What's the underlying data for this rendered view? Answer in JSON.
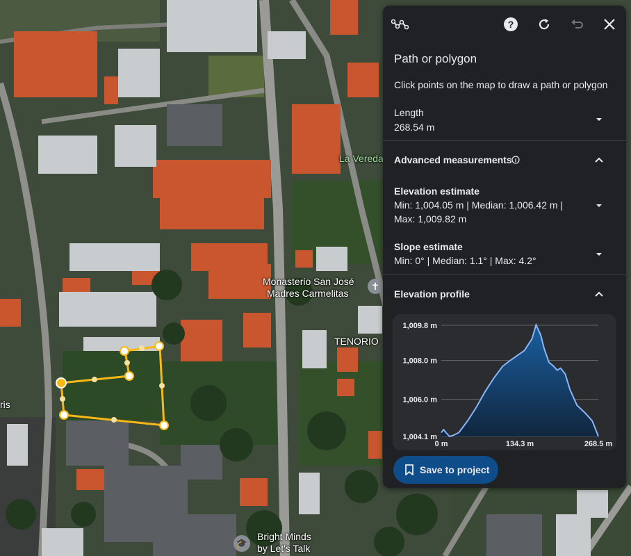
{
  "map": {
    "labels": {
      "la_vereda": "La Vereda",
      "monasterio_1": "Monasterio San José",
      "monasterio_2": "Madres Carmelitas",
      "tenorio": "TENORIO",
      "bright_minds_1": "Bright Minds",
      "bright_minds_2": "by Let's Talk",
      "left_edge": "ris"
    }
  },
  "panel": {
    "tool_icon": "path-measure-icon",
    "title": "Path or polygon",
    "instruction": "Click points on the map to draw a path or polygon",
    "length": {
      "label": "Length",
      "value": "268.54 m"
    },
    "advanced": {
      "label": "Advanced measurements"
    },
    "elevation": {
      "label": "Elevation estimate",
      "line1": "Min: 1,004.05 m | Median: 1,006.42 m |",
      "line2": "Max: 1,009.82 m"
    },
    "slope": {
      "label": "Slope estimate",
      "value": "Min: 0° | Median: 1.1° | Max: 4.2°"
    },
    "profile": {
      "label": "Elevation profile"
    },
    "save_label": "Save to project"
  },
  "colors": {
    "accent": "#0b57d0",
    "panel_bg": "#202124",
    "profile_line": "#8ab4f8",
    "polygon": "#f9b815"
  },
  "chart_data": {
    "type": "area",
    "title": "Elevation profile",
    "xlabel": "",
    "ylabel": "",
    "x_ticks": [
      "0 m",
      "134.3 m",
      "268.5 m"
    ],
    "y_ticks": [
      "1,009.8 m",
      "1,008.0 m",
      "1,006.0 m",
      "1,004.1 m"
    ],
    "y_tick_values": [
      1009.8,
      1008.0,
      1006.0,
      1004.1
    ],
    "xlim": [
      0,
      268.5
    ],
    "ylim": [
      1004.1,
      1009.8
    ],
    "x": [
      0,
      4,
      8,
      14,
      20,
      30,
      45,
      60,
      75,
      90,
      105,
      118,
      130,
      142,
      155,
      162,
      170,
      176,
      184,
      192,
      198,
      204,
      212,
      220,
      232,
      246,
      258,
      266,
      268.5
    ],
    "y": [
      1004.3,
      1004.45,
      1004.3,
      1004.1,
      1004.15,
      1004.3,
      1004.9,
      1005.6,
      1006.4,
      1007.1,
      1007.7,
      1008.0,
      1008.25,
      1008.5,
      1009.1,
      1009.82,
      1009.3,
      1008.6,
      1007.9,
      1007.7,
      1007.5,
      1007.6,
      1007.3,
      1006.5,
      1005.7,
      1005.3,
      1004.9,
      1004.3,
      1004.1
    ]
  }
}
